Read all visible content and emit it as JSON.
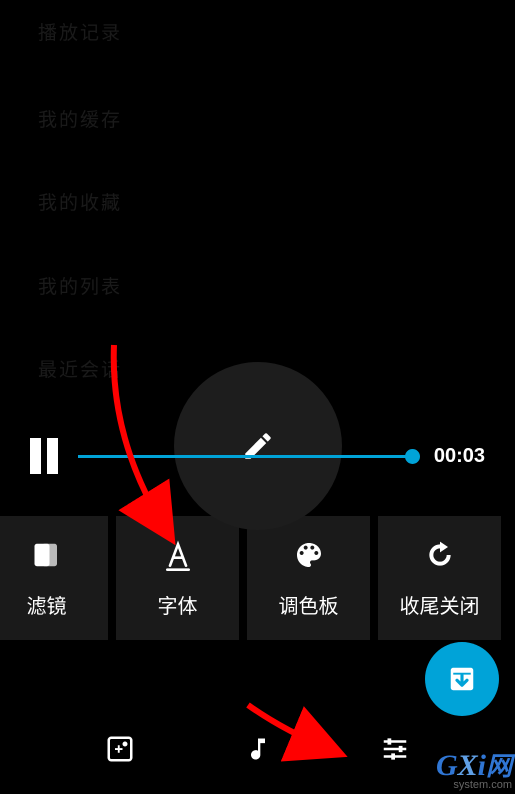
{
  "dim_items": [
    "播放记录",
    "我的缓存",
    "我的收藏",
    "我的列表",
    "最近会话"
  ],
  "playback": {
    "time": "00:03"
  },
  "effects": [
    "滤镜",
    "字体",
    "调色板",
    "收尾关闭"
  ],
  "watermark": {
    "brand_parts": [
      "G",
      "X",
      "i",
      "网"
    ],
    "domain": "system.com"
  }
}
